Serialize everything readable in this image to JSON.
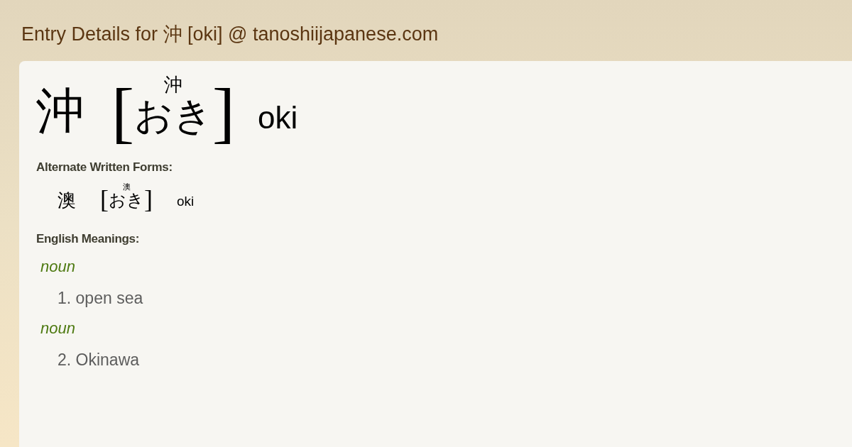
{
  "page_title": "Entry Details for 沖 [oki] @ tanoshiijapanese.com",
  "entry": {
    "kanji": "沖",
    "bracket_open": "[",
    "furigana": "沖",
    "kana": "おき",
    "bracket_close": "]",
    "romaji": "oki"
  },
  "alternate_forms": {
    "heading": "Alternate Written Forms:",
    "items": [
      {
        "kanji": "澳",
        "bracket_open": "[",
        "furigana": "澳",
        "kana": "おき",
        "bracket_close": "]",
        "romaji": "oki"
      }
    ]
  },
  "meanings": {
    "heading": "English Meanings:",
    "items": [
      {
        "pos": "noun",
        "text": "1. open sea"
      },
      {
        "pos": "noun",
        "text": "2. Okinawa"
      }
    ]
  }
}
